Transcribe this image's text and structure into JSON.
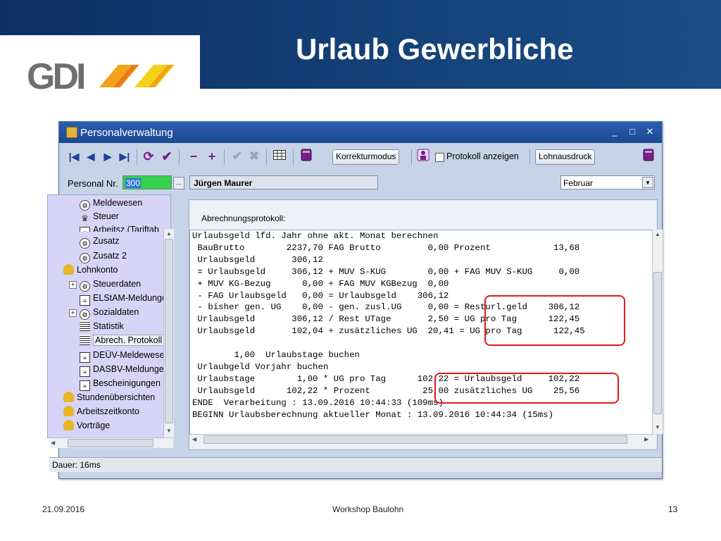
{
  "slide": {
    "title": "Urlaub Gewerbliche",
    "logo_text": "GDI",
    "footer_date": "21.09.2016",
    "footer_center": "Workshop Baulohn",
    "footer_page": "13"
  },
  "window": {
    "title": "Personalverwaltung",
    "controls": [
      "_",
      "□",
      "✕"
    ]
  },
  "toolbar": {
    "korrekturmodus": "Korrekturmodus",
    "protokoll_anzeigen": "Protokoll anzeigen",
    "lohnausdruck": "Lohnausdruck"
  },
  "header": {
    "personal_nr_label": "Personal Nr.",
    "personal_nr_value": "300",
    "employee_name": "Jürgen Maurer",
    "month": "Februar"
  },
  "tree": {
    "items": [
      {
        "label": "Meldewesen",
        "icon": "gear-icon"
      },
      {
        "label": "Steuer",
        "icon": "eagle-icon"
      },
      {
        "label": "Arbeitsz.(Tariftab",
        "icon": "form-icon"
      },
      {
        "label": "Zusatz",
        "icon": "gear-icon"
      },
      {
        "label": "Zusatz 2",
        "icon": "gear-icon"
      },
      {
        "label": "Lohnkonto",
        "icon": "people-icon"
      },
      {
        "label": "Steuerdaten",
        "icon": "gear-icon"
      },
      {
        "label": "ELStAM-Meldunge",
        "icon": "form-icon"
      },
      {
        "label": "Sozialdaten",
        "icon": "gear-icon"
      },
      {
        "label": "Statistik",
        "icon": "grid-icon"
      },
      {
        "label": "Abrech. Protokoll",
        "icon": "grid-icon"
      },
      {
        "label": "DEÜV-Meldewese",
        "icon": "form-icon"
      },
      {
        "label": "DASBV-Meldunge",
        "icon": "form-icon"
      },
      {
        "label": "Bescheinigungen",
        "icon": "form-icon"
      },
      {
        "label": "Stundenübersichten",
        "icon": "people-icon"
      },
      {
        "label": "Arbeitszeitkonto",
        "icon": "people-icon"
      },
      {
        "label": "Vorträge",
        "icon": "people-icon"
      }
    ]
  },
  "panel": {
    "label": "Abrechnungsprotokoll:",
    "lines": [
      "Urlaubsgeld lfd. Jahr ohne akt. Monat berechnen",
      " BauBrutto        2237,70 FAG Brutto         0,00 Prozent            13,68",
      " Urlaubsgeld       306,12",
      " = Urlaubsgeld     306,12 + MUV S-KUG        0,00 + FAG MUV S-KUG     0,00",
      " + MUV KG-Bezug      0,00 + FAG MUV KGBezug  0,00",
      " - FAG Urlaubsgeld   0,00 = Urlaubsgeld    306,12",
      " - bisher gen. UG    0,00 - gen. zusl.UG     0,00 = Resturl.geld    306,12",
      " Urlaubsgeld       306,12 / Rest UTage       2,50 = UG pro Tag      122,45",
      " Urlaubsgeld       102,04 + zusätzliches UG  20,41 = UG pro Tag      122,45",
      "",
      "        1,00  Urlaubstage buchen",
      " Urlaubgeld Vorjahr buchen",
      " Urlaubstage        1,00 * UG pro Tag      102,22 = Urlaubsgeld     102,22",
      " Urlaubsgeld      102,22 * Prozent          25,00 zusätzliches UG    25,56",
      "ENDE  Verarbeitung : 13.09.2016 10:44:33 (109ms)",
      "BEGINN Urlaubsberechnung aktueller Monat : 13.09.2016 10:44:34 (15ms)"
    ]
  },
  "status": {
    "text": "Dauer: 16ms"
  },
  "colors": {
    "banner": "#0c2f63",
    "tree_bg": "#d7d4f8",
    "pn_input_bg": "#33d14c",
    "highlight_box": "#e0191b"
  }
}
